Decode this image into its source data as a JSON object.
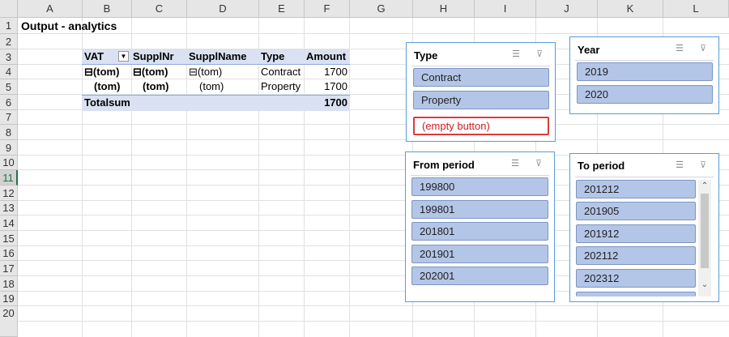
{
  "columns": [
    "A",
    "B",
    "C",
    "D",
    "E",
    "F",
    "G",
    "H",
    "I",
    "J",
    "K",
    "L"
  ],
  "rows": [
    "1",
    "2",
    "3",
    "4",
    "5",
    "6",
    "7",
    "8",
    "9",
    "10",
    "11",
    "12",
    "13",
    "14",
    "15",
    "16",
    "17",
    "18",
    "19",
    "20"
  ],
  "sheet": {
    "title": "Output - analytics"
  },
  "pivot": {
    "headers": {
      "vat": "VAT",
      "supplnr": "SupplNr",
      "supplname": "SupplName",
      "type": "Type",
      "amount": "Amount"
    },
    "rows": [
      {
        "vat": "(tom)",
        "supplnr": "(tom)",
        "supplname": "(tom)",
        "type": "Contract",
        "amount": "1700"
      },
      {
        "vat": "(tom)",
        "supplnr": "(tom)",
        "supplname": "(tom)",
        "type": "Property",
        "amount": "1700"
      }
    ],
    "collapse_glyph": "⊟",
    "total_label": "Totalsum",
    "total_amount": "1700",
    "dropdown_glyph": "▼"
  },
  "slicers": {
    "type": {
      "title": "Type",
      "items": [
        "Contract",
        "Property"
      ],
      "empty_label": "(empty button)"
    },
    "year": {
      "title": "Year",
      "items": [
        "2019",
        "2020"
      ]
    },
    "from_period": {
      "title": "From period",
      "items": [
        "199800",
        "199801",
        "201801",
        "201901",
        "202001"
      ]
    },
    "to_period": {
      "title": "To period",
      "items": [
        "201212",
        "201905",
        "201912",
        "202112",
        "202312"
      ]
    },
    "multiselect_glyph": "☰",
    "clear_glyph": "⊽",
    "scroll_up": "⌃",
    "scroll_down": "⌄"
  },
  "colors": {
    "slicer_border": "#5b9bd5",
    "item_fill": "#b4c6e7",
    "pivot_fill": "#d9e1f2",
    "empty_border": "#e03a3a"
  }
}
